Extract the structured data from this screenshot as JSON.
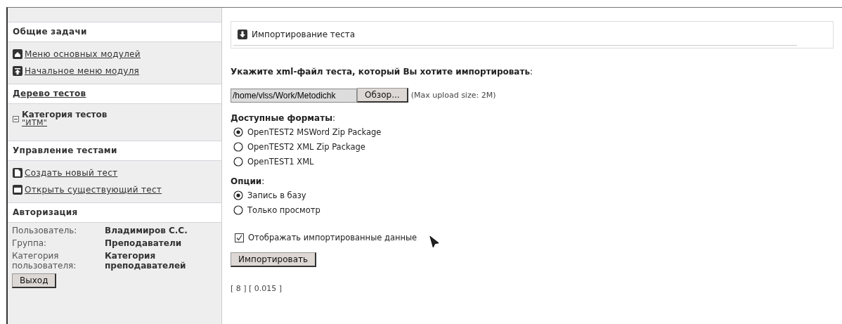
{
  "sidebar": {
    "sections": [
      {
        "title": "Общие задачи",
        "title_link": false,
        "kind": "links",
        "links": [
          {
            "label": "Меню основных модулей",
            "kind": "home"
          },
          {
            "label": "Начальное меню модуля",
            "kind": "top"
          }
        ]
      },
      {
        "title": "Дерево тестов",
        "title_link": true,
        "kind": "tree",
        "tree": [
          {
            "label": "Категория тестов",
            "link": "\"ИТМ\"",
            "expanded": true
          }
        ]
      },
      {
        "title": "Управление тестами",
        "title_link": false,
        "kind": "links",
        "links": [
          {
            "label": "Создать новый тест",
            "kind": "file"
          },
          {
            "label": "Открыть существующий тест",
            "kind": "folder"
          }
        ]
      },
      {
        "title": "Авторизация",
        "title_link": false,
        "kind": "auth",
        "rows": [
          {
            "label": "Пользователь:",
            "value": "Владимиров С.С."
          },
          {
            "label": "Группа:",
            "value": "Преподаватели"
          },
          {
            "label": "Категория пользователя:",
            "value": "Категория преподавателей"
          }
        ],
        "button": "Выход"
      }
    ]
  },
  "main": {
    "title": "Импортирование теста",
    "file_prompt": "**Укажите xml-файл теста, который Вы хотите импортировать**:",
    "file_value": "/home/vlss/Work/Metodichk",
    "browse_button": "Обзор...",
    "max_size": "(Max upload size: 2M)",
    "formats_label": "**Доступные форматы**:",
    "formats": [
      {
        "label": "OpenTEST2 MSWord Zip Package",
        "selected": true
      },
      {
        "label": "OpenTEST2 XML Zip Package",
        "selected": false
      },
      {
        "label": "OpenTEST1 XML",
        "selected": false
      }
    ],
    "options_label": "**Опции**:",
    "options": [
      {
        "label": "Запись в базу",
        "selected": true
      },
      {
        "label": "Только просмотр",
        "selected": false
      }
    ],
    "show_data": {
      "label": "Отображать импортированные данные",
      "checked": true
    },
    "import_button": "Импортировать",
    "footer": "[ 8 ] [ 0.015 ]"
  }
}
